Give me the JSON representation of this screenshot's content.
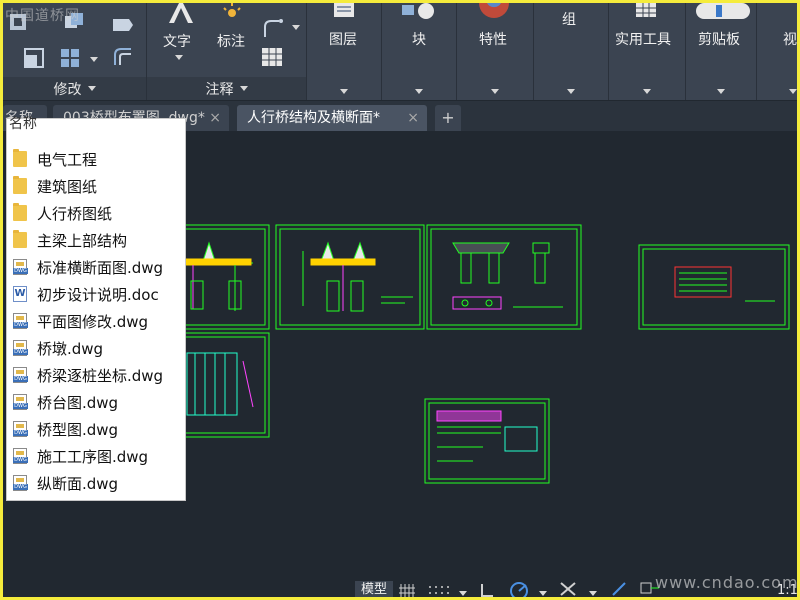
{
  "ribbon": {
    "watermark_top": "中国道桥网",
    "text_label": "文字",
    "dim_label": "标注",
    "layer_label": "图层",
    "block_label": "块",
    "props_label": "特性",
    "group_label": "组",
    "utility_label": "实用工具",
    "clipboard_label": "剪贴板",
    "view_label": "视",
    "modify_panel": "修改",
    "annotation_panel": "注释"
  },
  "tabs": [
    {
      "label": "名称",
      "close": ""
    },
    {
      "label": "003桥型布置图 .dwg*",
      "close": "×"
    },
    {
      "label": "人行桥结构及横断面*",
      "close": "×"
    }
  ],
  "tab_add": "+",
  "popup": {
    "header": "名称",
    "items": [
      {
        "label": "电气工程",
        "icon": "folder-icon"
      },
      {
        "label": "建筑图纸",
        "icon": "folder-icon"
      },
      {
        "label": "人行桥图纸",
        "icon": "folder-icon"
      },
      {
        "label": "主梁上部结构",
        "icon": "folder-icon"
      },
      {
        "label": "标准横断面图.dwg",
        "icon": "dwg-file-icon"
      },
      {
        "label": "初步设计说明.doc",
        "icon": "doc-file-icon"
      },
      {
        "label": "平面图修改.dwg",
        "icon": "dwg-file-icon"
      },
      {
        "label": "桥墩.dwg",
        "icon": "dwg-file-icon"
      },
      {
        "label": "桥梁逐桩坐标.dwg",
        "icon": "dwg-file-icon"
      },
      {
        "label": "桥台图.dwg",
        "icon": "dwg-file-icon"
      },
      {
        "label": "桥型图.dwg",
        "icon": "dwg-file-icon"
      },
      {
        "label": "施工工序图.dwg",
        "icon": "dwg-file-icon"
      },
      {
        "label": "纵断面.dwg",
        "icon": "dwg-file-icon"
      }
    ]
  },
  "status": {
    "model_label": "模型",
    "scale_label": "1:1",
    "watermark_bottom": "www.cndao.com"
  },
  "colors": {
    "app_bg": "#212830",
    "ribbon_bg": "#3b4451",
    "drawing_line": "#22ff22",
    "border_yellow": "#f5ec3c"
  }
}
